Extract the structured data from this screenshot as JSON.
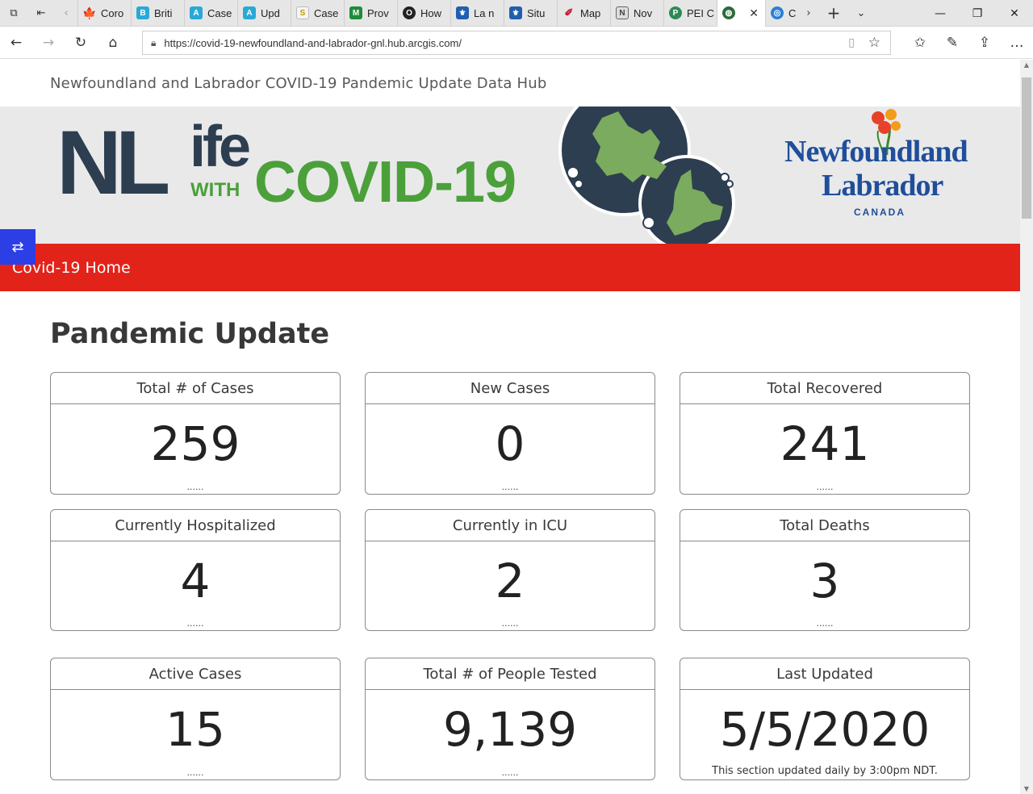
{
  "browser": {
    "tabs": [
      {
        "label": "Coro",
        "icon": "maple-leaf-icon",
        "color": "#d52b1e"
      },
      {
        "label": "Briti",
        "icon": "bc-icon",
        "color": "#2aa9d6"
      },
      {
        "label": "Case",
        "icon": "alberta-icon",
        "color": "#2aa9d6"
      },
      {
        "label": "Upd",
        "icon": "alberta-icon",
        "color": "#2aa9d6"
      },
      {
        "label": "Case",
        "icon": "sask-icon",
        "color": "#e6b800"
      },
      {
        "label": "Prov",
        "icon": "manitoba-icon",
        "color": "#1e8c3a"
      },
      {
        "label": "How",
        "icon": "ontario-icon",
        "color": "#222222"
      },
      {
        "label": "La n",
        "icon": "quebec-icon",
        "color": "#1f5fad"
      },
      {
        "label": "Situ",
        "icon": "quebec-icon",
        "color": "#1f5fad"
      },
      {
        "label": "Map",
        "icon": "nb-icon",
        "color": "#c8102e"
      },
      {
        "label": "Nov",
        "icon": "ns-icon",
        "color": "#444444"
      },
      {
        "label": "PEI C",
        "icon": "pei-icon",
        "color": "#2d8a57"
      }
    ],
    "active_tab": {
      "label": "",
      "icon": "globe-icon"
    },
    "next_tab": {
      "label": "C",
      "icon": "arcgis-icon"
    },
    "url": "https://covid-19-newfoundland-and-labrador-gnl.hub.arcgis.com/"
  },
  "site": {
    "title": "Newfoundland and Labrador COVID-19 Pandemic Update Data Hub",
    "banner": {
      "nl": "NL",
      "life": "ife",
      "with": "WITH",
      "covid": "COVID-19",
      "prov_name1": "Newfoundland",
      "prov_name2": "Labrador",
      "prov_country": "CANADA"
    },
    "nav_home": "Covid-19 Home",
    "section_title": "Pandemic Update"
  },
  "cards": [
    {
      "title": "Total # of Cases",
      "value": "259",
      "foot": "......"
    },
    {
      "title": "New Cases",
      "value": "0",
      "foot": "......"
    },
    {
      "title": "Total Recovered",
      "value": "241",
      "foot": "......"
    },
    {
      "title": "Currently Hospitalized",
      "value": "4",
      "foot": "......"
    },
    {
      "title": "Currently in ICU",
      "value": "2",
      "foot": "......"
    },
    {
      "title": "Total Deaths",
      "value": "3",
      "foot": "......"
    },
    {
      "title": "Active Cases",
      "value": "15",
      "foot": "......"
    },
    {
      "title": "Total # of People Tested",
      "value": "9,139",
      "foot": "......"
    },
    {
      "title": "Last Updated",
      "value": "5/5/2020",
      "foot": "This section updated daily by 3:00pm NDT."
    }
  ],
  "colors": {
    "accent_red": "#e2231a",
    "brand_navy": "#2d3e50",
    "brand_green": "#4ba03a",
    "a11y_blue": "#2c3ee6"
  }
}
